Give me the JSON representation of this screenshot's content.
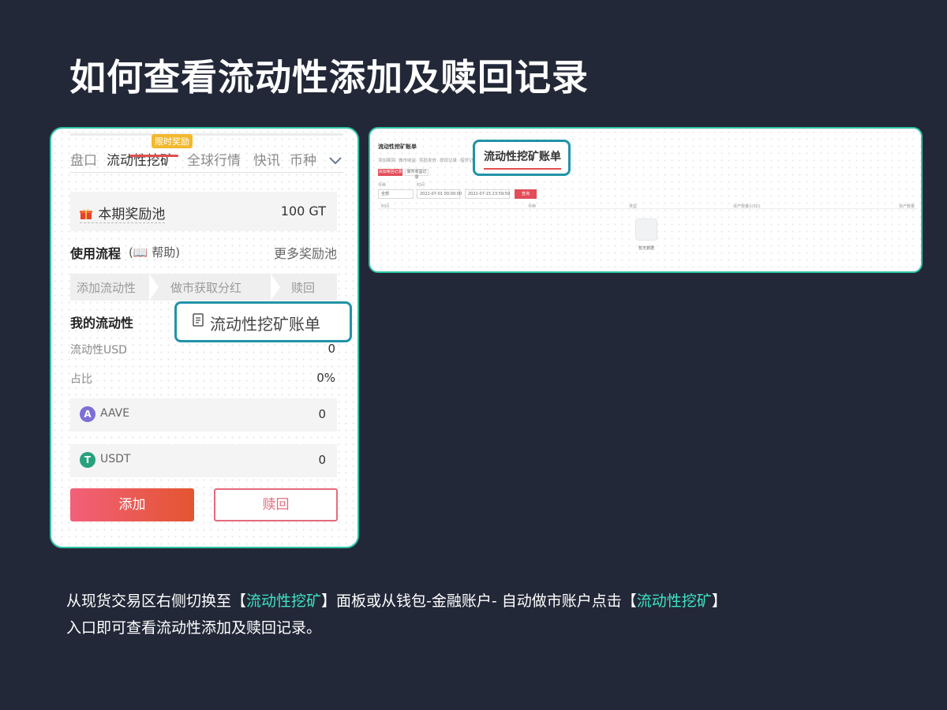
{
  "title": "如何查看流动性添加及赎回记录",
  "left_panel": {
    "tabs": [
      "盘口",
      "流动性挖矿",
      "全球行情",
      "快讯",
      "币种"
    ],
    "tab_badge": "限时奖励",
    "pool_label": "本期奖励池",
    "pool_value": "100 GT",
    "flow_title": "使用流程",
    "flow_help": "(📖 帮助)",
    "flow_more": "更多奖励池",
    "steps": [
      "添加流动性",
      "做市获取分红",
      "赎回"
    ],
    "my_liquidity": "我的流动性",
    "bill_link": "流动性挖矿账单",
    "liquidity_usd_label": "流动性USD",
    "liquidity_usd_value": "0",
    "ratio_label": "占比",
    "ratio_value": "0%",
    "assets": [
      {
        "name": "AAVE",
        "value": "0",
        "color": "#7d6fd6"
      },
      {
        "name": "USDT",
        "value": "0",
        "color": "#26a17b"
      }
    ],
    "add_button": "添加",
    "redeem_button": "赎回"
  },
  "right_panel": {
    "title": "流动性挖矿账单",
    "tabs": [
      "添加赎回",
      "做市收益",
      "奖励发放",
      "提现记录",
      "借贷记录"
    ],
    "btn_primary": "添加赎回记录",
    "btn_secondary": "做市收益记录",
    "label_currency": "币种",
    "label_time": "时间",
    "currency_value": "全部",
    "date_from": "2021-07-01 00:00:00",
    "date_to": "2021-07-15 23:59:59",
    "query_button": "查询",
    "columns": [
      "时间",
      "币种",
      "类型",
      "资产数量(USD)",
      "资产数量"
    ],
    "empty_text": "暂无数据",
    "highlight": "流动性挖矿账单"
  },
  "caption": {
    "line1_a": "从现货交易区右侧切换至【",
    "line1_hl1": "流动性挖矿",
    "line1_b": "】面板或从钱包-金融账户- 自动做市账户点击【",
    "line1_hl2": "流动性挖矿",
    "line1_c": "】",
    "line2": "入口即可查看流动性添加及赎回记录。"
  }
}
